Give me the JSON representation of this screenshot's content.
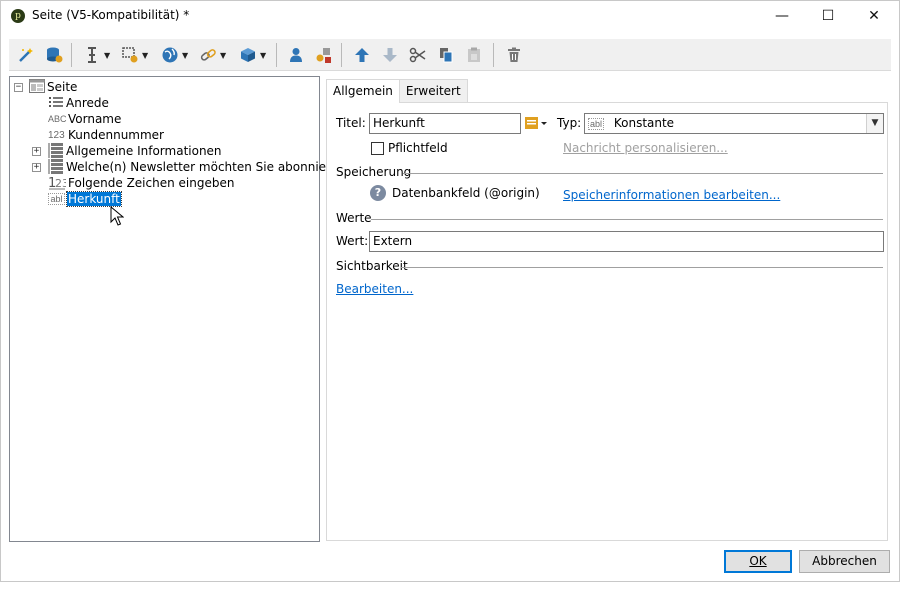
{
  "window": {
    "title": "Seite (V5-Kompatibilität) *",
    "app_icon_glyph": "p",
    "minimize_glyph": "—",
    "maximize_glyph": "☐",
    "close_glyph": "✕"
  },
  "toolbar": {
    "buttons": [
      {
        "icon": "wizard-icon"
      },
      {
        "icon": "database-icon"
      },
      {
        "icon": "text-cursor-icon",
        "dropdown": true
      },
      {
        "icon": "form-control-icon",
        "dropdown": true
      },
      {
        "icon": "globe-icon",
        "dropdown": true
      },
      {
        "icon": "link-icon",
        "dropdown": true
      },
      {
        "icon": "cube-icon",
        "dropdown": true
      },
      {
        "icon": "user-icon"
      },
      {
        "icon": "add-shapes-icon"
      },
      {
        "icon": "move-up-icon"
      },
      {
        "icon": "move-down-icon"
      },
      {
        "icon": "cut-icon"
      },
      {
        "icon": "copy-icon"
      },
      {
        "icon": "paste-icon"
      },
      {
        "icon": "delete-icon"
      }
    ]
  },
  "tree": {
    "root": {
      "label": "Seite",
      "expander": "−"
    },
    "items": [
      {
        "label": "Anrede",
        "icon": "list-icon",
        "expander": ""
      },
      {
        "label": "Vorname",
        "icon": "text-field-icon",
        "icon_text": "ABC",
        "expander": ""
      },
      {
        "label": "Kundennummer",
        "icon": "number-field-icon",
        "icon_text": "123",
        "expander": ""
      },
      {
        "label": "Allgemeine Informationen",
        "icon": "group-icon",
        "expander": "+"
      },
      {
        "label": "Welche(n) Newsletter möchten Sie abonnieren?",
        "icon": "group-icon",
        "expander": "+"
      },
      {
        "label": "Folgende Zeichen eingeben",
        "icon": "captcha-icon",
        "icon_text": "1̲2̲3",
        "expander": ""
      },
      {
        "label": "Herkunft",
        "icon": "hidden-field-icon",
        "icon_text": "abl",
        "expander": "",
        "selected": true
      }
    ]
  },
  "tabs": [
    {
      "label": "Allgemein",
      "active": true
    },
    {
      "label": "Erweitert",
      "active": false
    }
  ],
  "form": {
    "titel_label": "Titel:",
    "titel_value": "Herkunft",
    "typ_label": "Typ:",
    "typ_value": "Konstante",
    "typ_icon_text": "abl",
    "pflichtfeld_label": "Pflichtfeld",
    "pflichtfeld_checked": false,
    "nachricht_link": "Nachricht personalisieren...",
    "speicherung_heading": "Speicherung",
    "datenbankfeld_text": "Datenbankfeld (@origin)",
    "speicherinfo_link": "Speicherinformationen bearbeiten...",
    "werte_heading": "Werte",
    "wert_label": "Wert:",
    "wert_value": "Extern",
    "sichtbarkeit_heading": "Sichtbarkeit",
    "bearbeiten_link": "Bearbeiten..."
  },
  "buttons": {
    "ok": "OK",
    "cancel": "Abbrechen"
  },
  "colors": {
    "selection": "#0078d7",
    "link": "#0066cc",
    "link_disabled": "#a0a0a0",
    "toolbar_blue": "#2e75b6"
  }
}
